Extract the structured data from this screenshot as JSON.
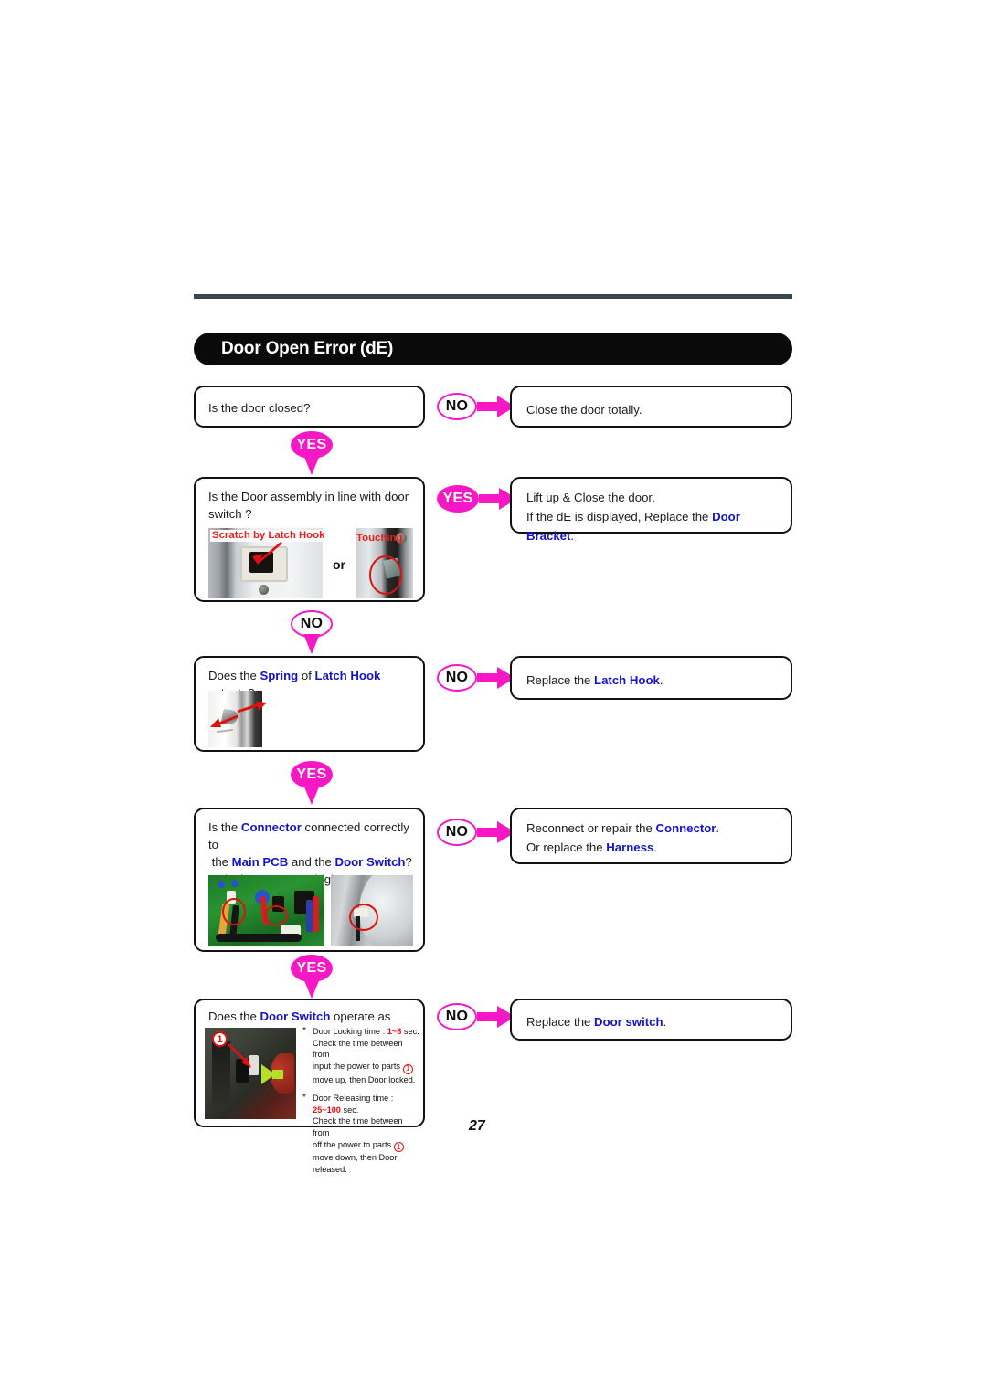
{
  "document": {
    "title": "Door Open Error (dE)",
    "page_number": "27"
  },
  "colors": {
    "accent_magenta": "#f618c4",
    "term_blue": "#1414cc",
    "annotation_red": "#e01010",
    "title_bar": "#0a0a0a",
    "rule": "#3b4750"
  },
  "flow": {
    "steps": [
      {
        "id": "step-1",
        "question": "Is the door closed?",
        "branch_label": "NO",
        "answer_lines": [
          "Close the door totally."
        ],
        "next_label": "YES"
      },
      {
        "id": "step-2",
        "question_lines": [
          "Is the Door assembly in line with door",
          "switch ?"
        ],
        "branch_label": "YES",
        "answer_lines": [
          "Lift up & Close the door.",
          "If the dE is displayed, Replace the Door Bracket."
        ],
        "answer_terms": [
          "Door Bracket"
        ],
        "next_label": "NO",
        "photo_labels": [
          "Scratch by Latch Hook",
          "Touching"
        ],
        "photo_connector": "or"
      },
      {
        "id": "step-3",
        "question": "Does the Spring of Latch Hook actuate?",
        "question_terms": [
          "Spring",
          "Latch Hook"
        ],
        "branch_label": "NO",
        "answer_lines": [
          "Replace the Latch Hook."
        ],
        "answer_terms": [
          "Latch Hook"
        ],
        "next_label": "YES"
      },
      {
        "id": "step-4",
        "question_lines": [
          "Is the Connector connected correctly to",
          "the Main PCB and the Door Switch?",
          "Or is the Harness alright ?"
        ],
        "question_terms": [
          "Connector",
          "Main PCB",
          "Door Switch",
          "Harness"
        ],
        "branch_label": "NO",
        "answer_lines": [
          "Reconnect or repair the Connector.",
          "Or replace the Harness."
        ],
        "answer_terms": [
          "Connector",
          "Harness"
        ],
        "next_label": "YES"
      },
      {
        "id": "step-5",
        "question": "Does the Door Switch operate as follows?",
        "question_terms": [
          "Door Switch"
        ],
        "branch_label": "NO",
        "answer_lines": [
          "Replace the Door switch."
        ],
        "answer_terms": [
          "Door switch"
        ],
        "specs": [
          {
            "heading": "Door Locking time :",
            "value": "1~8",
            "unit": "sec.",
            "detail_lines": [
              "Check the time between from",
              "input the power to parts",
              "move up, then Door locked."
            ],
            "part_number": "1"
          },
          {
            "heading": "Door Releasing time :",
            "value": "25~100",
            "unit": "sec.",
            "detail_lines": [
              "Check the time between from",
              "off the power to parts",
              "move down, then Door released."
            ],
            "part_number": "1"
          }
        ],
        "photo_number_label": "1"
      }
    ]
  }
}
